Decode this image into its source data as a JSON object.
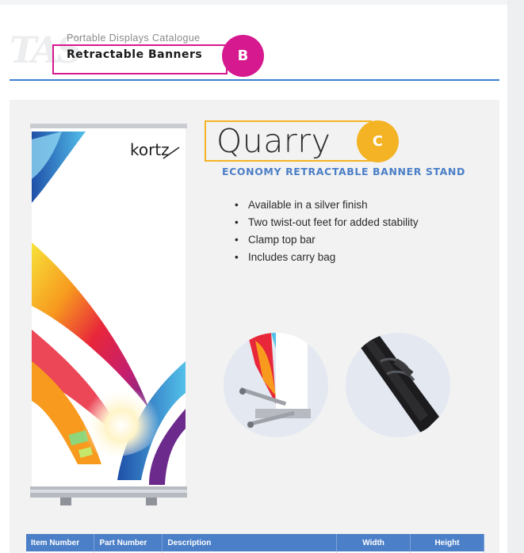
{
  "header": {
    "logo_text": "TAS",
    "catalogue": "Portable Displays Catalogue",
    "section": "Retractable Banners",
    "badge_b": "B",
    "badge_c": "C"
  },
  "product": {
    "name": "Quarry",
    "subtitle": "ECONOMY RETRACTABLE BANNER STAND",
    "features": [
      "Available in a silver finish",
      "Two twist-out feet for added stability",
      "Clamp top bar",
      "Includes carry bag"
    ],
    "banner_brand": "kortz"
  },
  "table": {
    "headers": [
      "Item Number",
      "Part Number",
      "Description",
      "Width",
      "Height"
    ]
  },
  "colors": {
    "accent_blue": "#4b7fc7",
    "highlight_magenta": "#d6198e",
    "highlight_orange": "#f4b324"
  }
}
